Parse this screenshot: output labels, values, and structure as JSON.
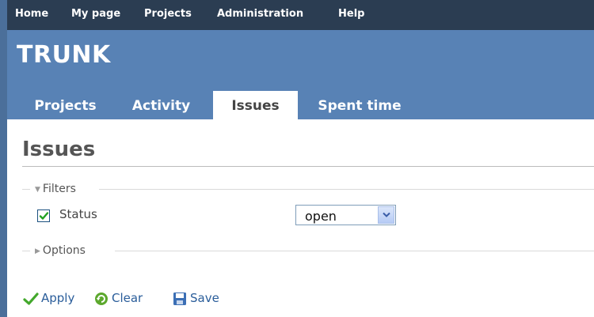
{
  "top_menu": {
    "items": [
      "Home",
      "My page",
      "Projects",
      "Administration",
      "Help"
    ]
  },
  "header": {
    "project_title": "TRUNK",
    "tabs": [
      "Projects",
      "Activity",
      "Issues",
      "Spent time"
    ],
    "selected_tab": "Issues"
  },
  "main": {
    "title": "Issues",
    "filters_legend": "Filters",
    "status_label": "Status",
    "status_checked": true,
    "status_value": "open",
    "options_legend": "Options",
    "actions": [
      "Apply",
      "Clear",
      "Save"
    ]
  },
  "colors": {
    "top_menu_bg": "#2b3d52",
    "header_bg": "#5882b5",
    "link": "#2a5d9a"
  },
  "icons": {
    "filters_toggle": "triangle-down-icon",
    "options_toggle": "triangle-right-icon",
    "apply": "checkmark-icon",
    "clear": "reload-icon",
    "save": "floppy-disk-icon"
  }
}
